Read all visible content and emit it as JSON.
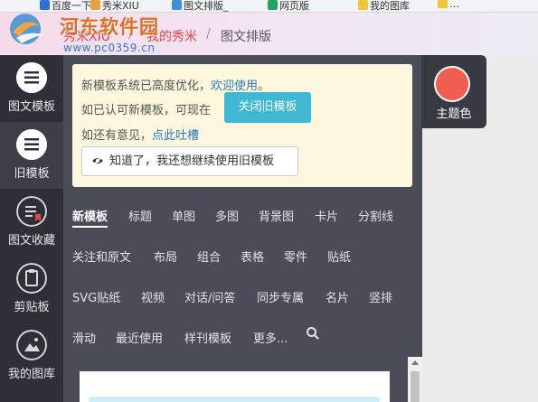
{
  "bookmarks": [
    "百度一下",
    "秀米XIU",
    "图文排版_",
    "网页版",
    "我的图库"
  ],
  "breadcrumb": {
    "item1": "秀米XIU",
    "sep": "/",
    "item2": "我的秀米",
    "current": "图文排版"
  },
  "watermark": {
    "title": "河东软件园",
    "url": "www.pc0359.cn"
  },
  "sidebar": {
    "items": [
      {
        "label": "图文模板",
        "icon": "list-icon"
      },
      {
        "label": "旧模板",
        "icon": "list-icon"
      },
      {
        "label": "图文收藏",
        "icon": "bookmark-list-icon"
      },
      {
        "label": "剪贴板",
        "icon": "clipboard-icon"
      },
      {
        "label": "我的图库",
        "icon": "image-icon"
      }
    ]
  },
  "notice": {
    "line1_text": "新模板系统已高度优化，",
    "line1_link": "欢迎使用",
    "line1_end": "。",
    "line2_text": "如已认可新模板，可现在",
    "close_old_button": "关闭旧模板",
    "line3_text": "如还有意见，",
    "line3_link": "点此吐槽",
    "keep_old_button": "知道了，我还想继续使用旧模板"
  },
  "tabs": [
    "新模板",
    "标题",
    "单图",
    "多图",
    "背景图",
    "卡片",
    "分割线",
    "关注和原文",
    "布局",
    "组合",
    "表格",
    "零件",
    "贴纸",
    "SVG贴纸",
    "视频",
    "对话/问答",
    "同步专属",
    "名片",
    "竖排",
    "滑动",
    "最近使用",
    "样刊模板",
    "更多..."
  ],
  "theme": {
    "label": "主题色",
    "color": "#f15e4f"
  }
}
